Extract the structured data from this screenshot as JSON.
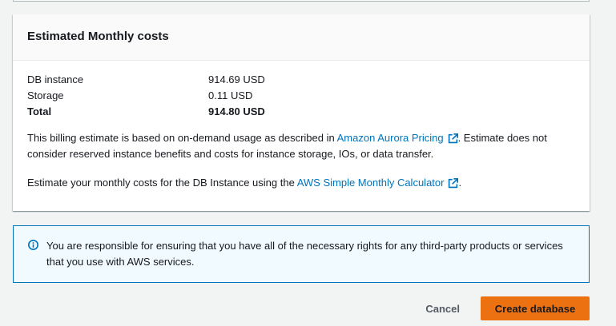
{
  "costs_panel": {
    "title": "Estimated Monthly costs",
    "rows": [
      {
        "label": "DB instance",
        "value": "914.69 USD"
      },
      {
        "label": "Storage",
        "value": "0.11 USD"
      },
      {
        "label": "Total",
        "value": "914.80 USD"
      }
    ],
    "billing_text_before": "This billing estimate is based on on-demand usage as described in ",
    "billing_link": "Amazon Aurora Pricing",
    "billing_text_after": ". Estimate does not consider reserved instance benefits and costs for instance storage, IOs, or data transfer.",
    "calc_text_before": "Estimate your monthly costs for the DB Instance using the ",
    "calc_link": "AWS Simple Monthly Calculator",
    "calc_text_after": "."
  },
  "info_alert": {
    "text": "You are responsible for ensuring that you have all of the necessary rights for any third-party products or services that you use with AWS services.",
    "icon": "info-icon"
  },
  "actions": {
    "cancel_label": "Cancel",
    "create_label": "Create database"
  },
  "colors": {
    "link": "#0073bb",
    "primary_button": "#ec7211",
    "alert_border": "#0073bb",
    "alert_bg": "#f1faff"
  }
}
